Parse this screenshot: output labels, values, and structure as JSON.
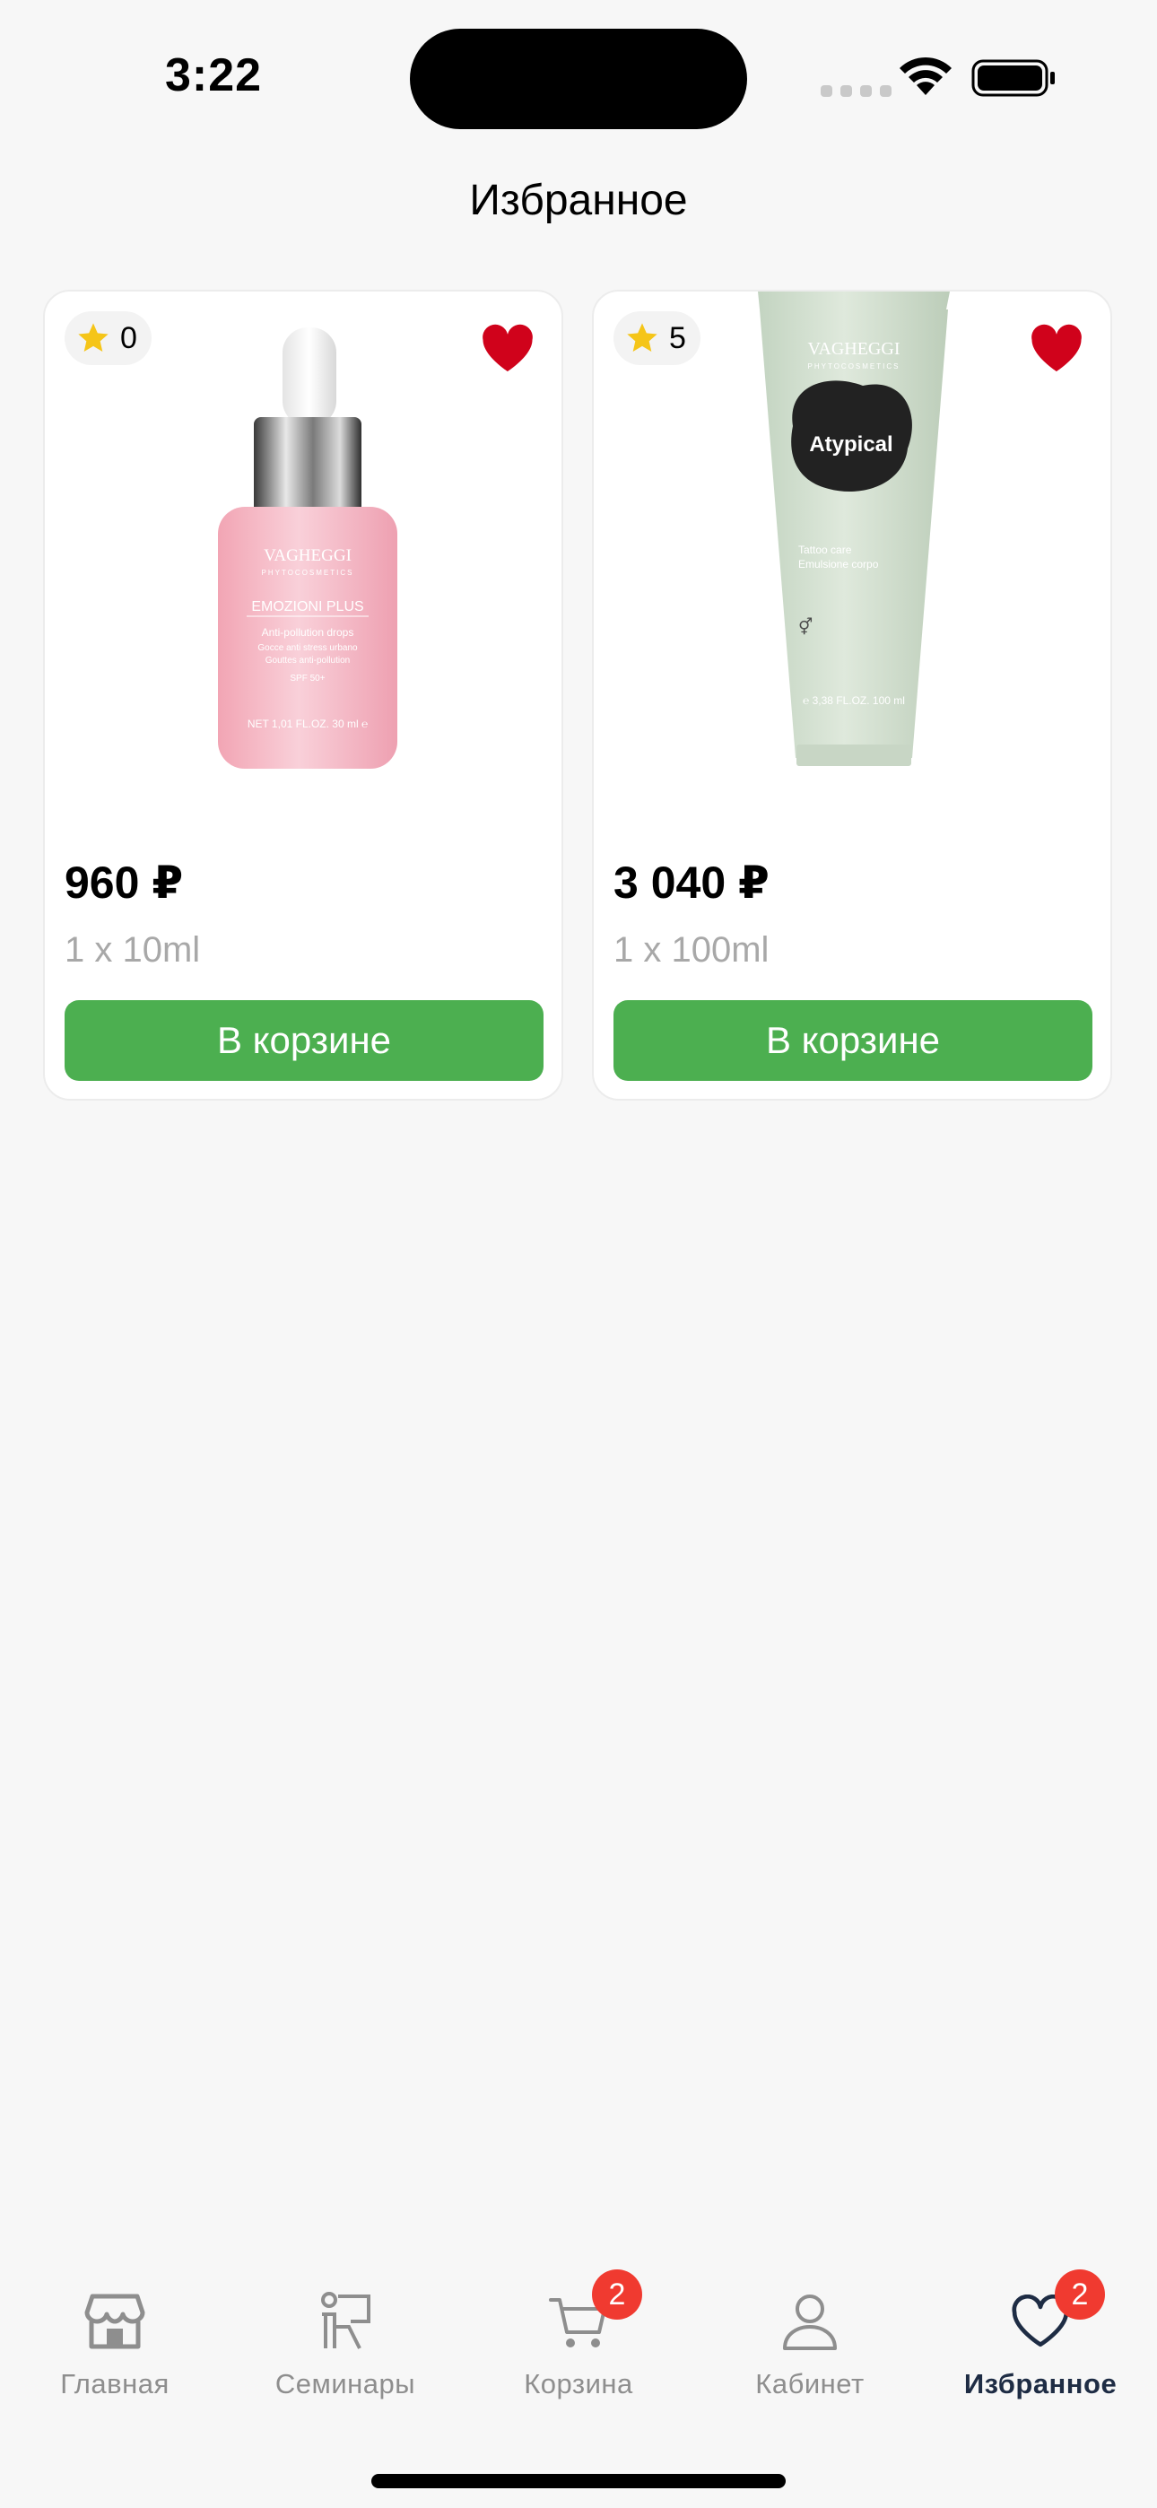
{
  "status_bar": {
    "time": "3:22"
  },
  "header": {
    "title": "Избранное"
  },
  "products": [
    {
      "rating": "0",
      "brand": "VAGHEGGI",
      "brand_sub": "PHYTOCOSMETICS",
      "line": "EMOZIONI PLUS",
      "name": "Anti-pollution drops",
      "desc1": "Gocce anti stress urbano",
      "desc2": "Gouttes anti-pollution",
      "spf": "SPF 50+",
      "net": "NET 1,01 FL.OZ. 30 ml ℮",
      "price": "960 ₽",
      "volume": "1 x 10ml",
      "cart_label": "В корзине",
      "favorited": true
    },
    {
      "rating": "5",
      "brand": "VAGHEGGI",
      "brand_sub": "PHYTOCOSMETICS",
      "line": "Atypical",
      "name": "Tattoo care",
      "desc1": "Emulsione corpo",
      "net": "℮ 3,38 FL.OZ. 100 ml",
      "price": "3 040 ₽",
      "volume": "1 x 100ml",
      "cart_label": "В корзине",
      "favorited": true
    }
  ],
  "tabbar": {
    "items": [
      {
        "label": "Главная",
        "icon": "store-icon"
      },
      {
        "label": "Семинары",
        "icon": "seminar-icon"
      },
      {
        "label": "Корзина",
        "icon": "cart-icon",
        "badge": "2"
      },
      {
        "label": "Кабинет",
        "icon": "user-icon"
      },
      {
        "label": "Избранное",
        "icon": "heart-icon",
        "badge": "2",
        "active": true
      }
    ]
  },
  "colors": {
    "accent_green": "#4caf50",
    "heart_red": "#d0021b",
    "badge_red": "#f03a30",
    "active_tab": "#1e2c44",
    "star": "#f5c518"
  }
}
